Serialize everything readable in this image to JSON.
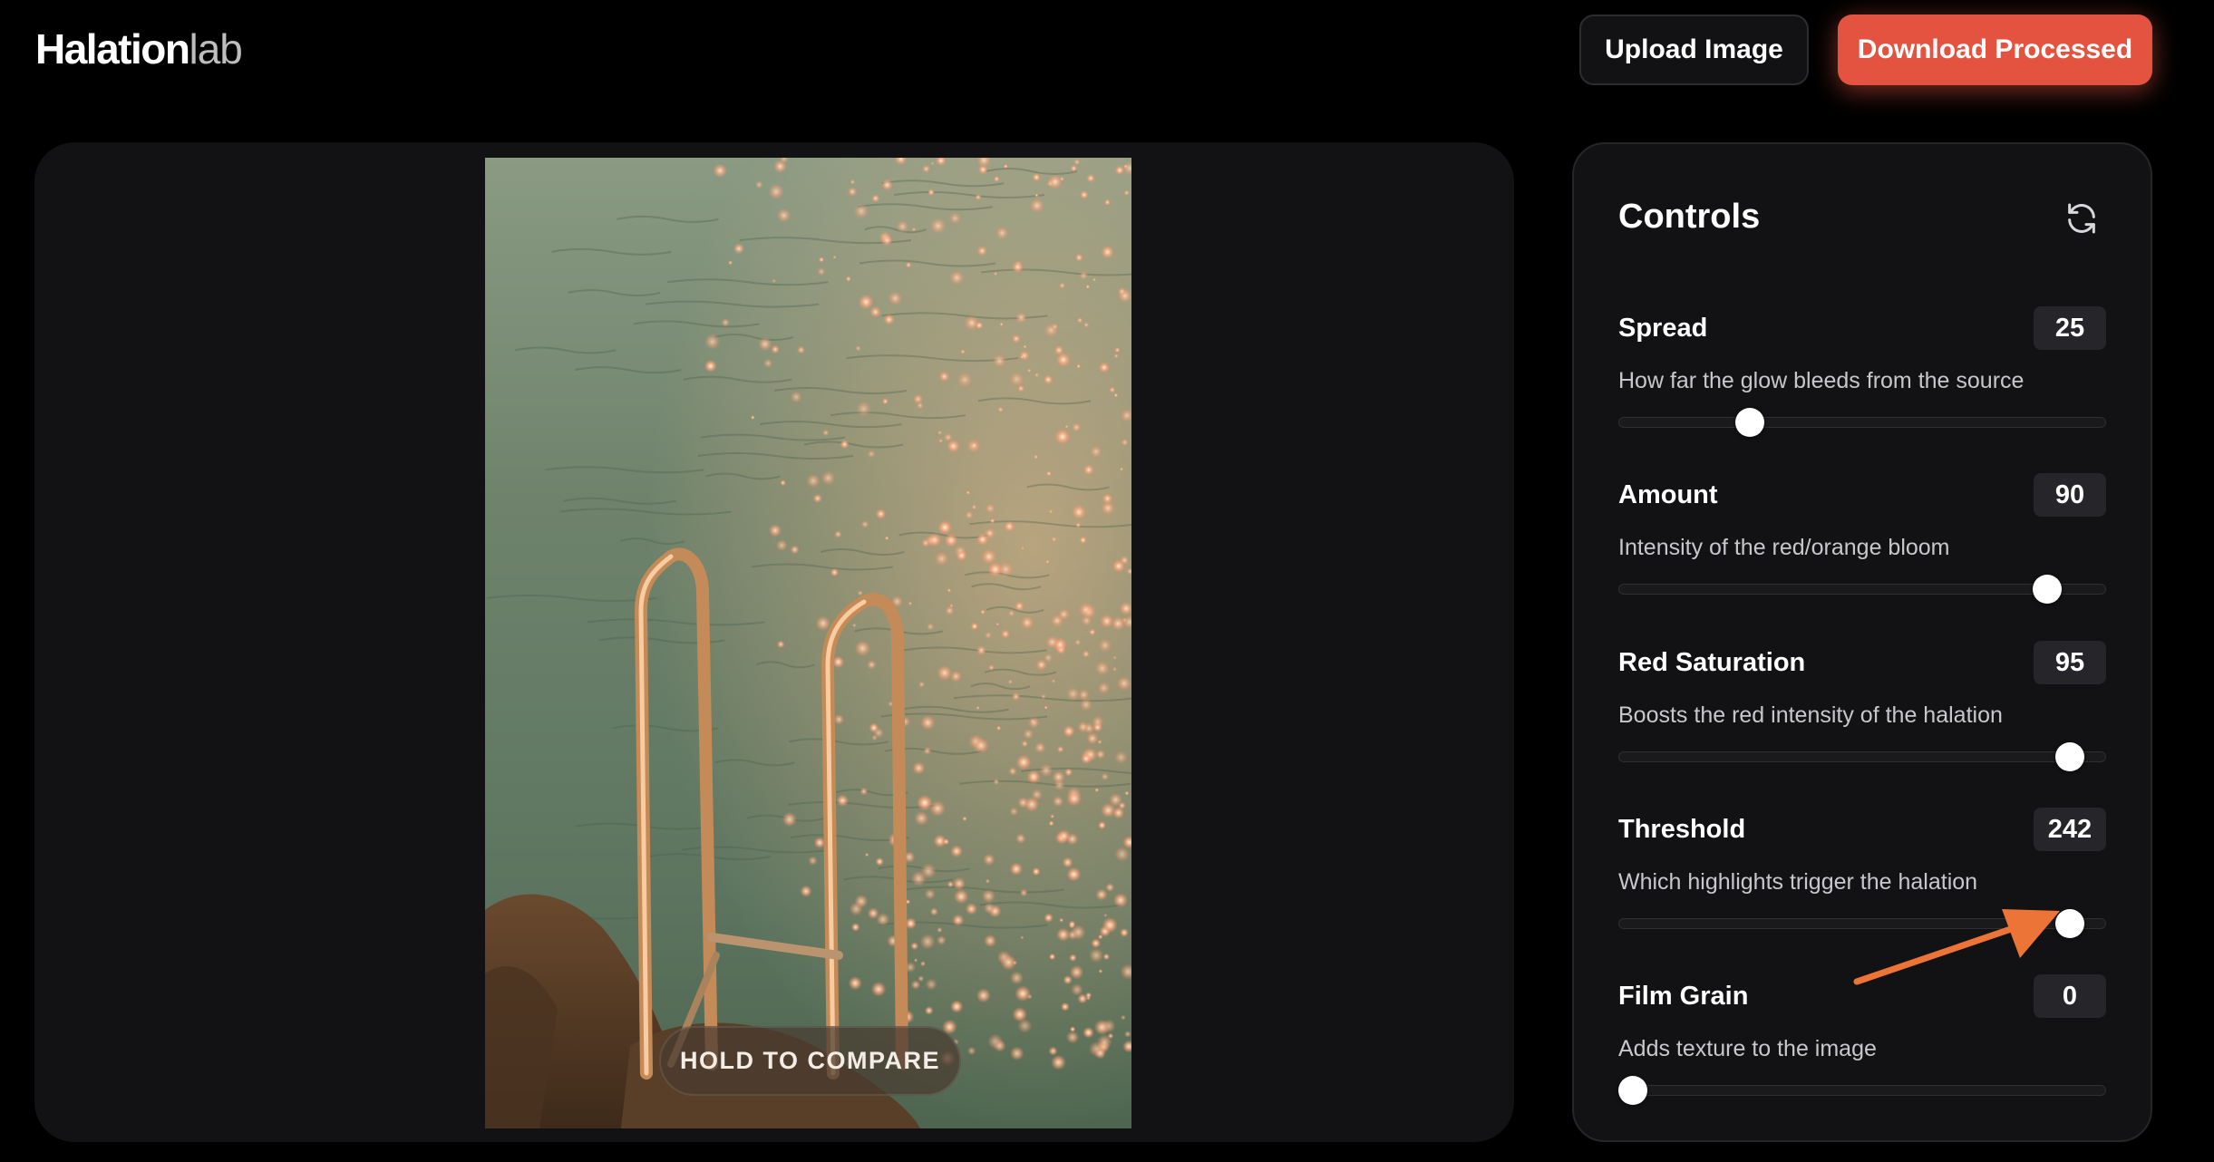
{
  "header": {
    "logo_bold": "Halation",
    "logo_light": "lab",
    "upload_label": "Upload Image",
    "download_label": "Download Processed"
  },
  "preview": {
    "compare_label": "HOLD TO COMPARE"
  },
  "controls": {
    "title": "Controls",
    "reset_icon": "refresh-icon",
    "sliders": [
      {
        "label": "Spread",
        "value": "25",
        "description": "How far the glow bleeds from the source",
        "fraction": 0.27
      },
      {
        "label": "Amount",
        "value": "90",
        "description": "Intensity of the red/orange bloom",
        "fraction": 0.88
      },
      {
        "label": "Red Saturation",
        "value": "95",
        "description": "Boosts the red intensity of the halation",
        "fraction": 0.925
      },
      {
        "label": "Threshold",
        "value": "242",
        "description": "Which highlights trigger the halation",
        "fraction": 0.925
      },
      {
        "label": "Film Grain",
        "value": "0",
        "description": "Adds texture to the image",
        "fraction": 0.03
      }
    ]
  },
  "colors": {
    "accent": "#e4533f",
    "annotation_arrow": "#ec7436",
    "panel_bg": "#121214"
  }
}
